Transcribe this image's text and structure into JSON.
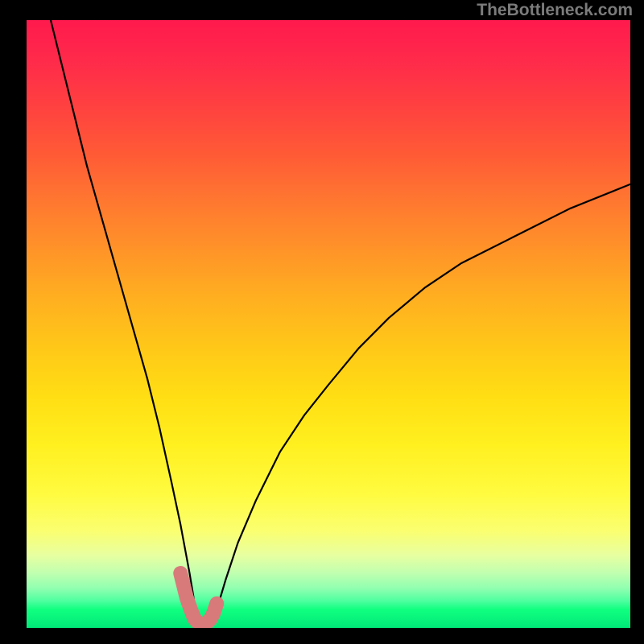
{
  "attribution": "TheBottleneck.com",
  "chart_data": {
    "type": "line",
    "title": "",
    "xlabel": "",
    "ylabel": "",
    "xlim": [
      0,
      100
    ],
    "ylim": [
      0,
      100
    ],
    "grid": false,
    "legend": false,
    "description": "Bottleneck percentage curve with a single sharp minimum. Y (bottleneck %) approaches 100 at the left edge, falls steeply to ~0 near x≈29, then rises concavely toward ~73 at the right edge. A short salmon segment highlights the flat bottom of the curve.",
    "series": [
      {
        "name": "bottleneck-curve",
        "color": "#000000",
        "x": [
          4,
          6,
          8,
          10,
          12,
          14,
          16,
          18,
          20,
          22,
          24,
          25.5,
          27,
          28,
          29,
          30,
          31.5,
          33,
          35,
          38,
          42,
          46,
          50,
          55,
          60,
          66,
          72,
          80,
          90,
          100
        ],
        "values": [
          100,
          92,
          84,
          76,
          69,
          62,
          55,
          48,
          41,
          33,
          24,
          17,
          9,
          3,
          0.5,
          1,
          3,
          8,
          14,
          21,
          29,
          35,
          40,
          46,
          51,
          56,
          60,
          64,
          69,
          73
        ]
      },
      {
        "name": "bottom-highlight",
        "color": "#d87a7a",
        "x": [
          25.5,
          26.5,
          27.2,
          27.8,
          28.5,
          29,
          29.8,
          30.5,
          31,
          31.5
        ],
        "values": [
          9,
          5,
          3,
          1.5,
          0.8,
          0.5,
          0.8,
          1.5,
          2.5,
          4
        ]
      }
    ]
  }
}
